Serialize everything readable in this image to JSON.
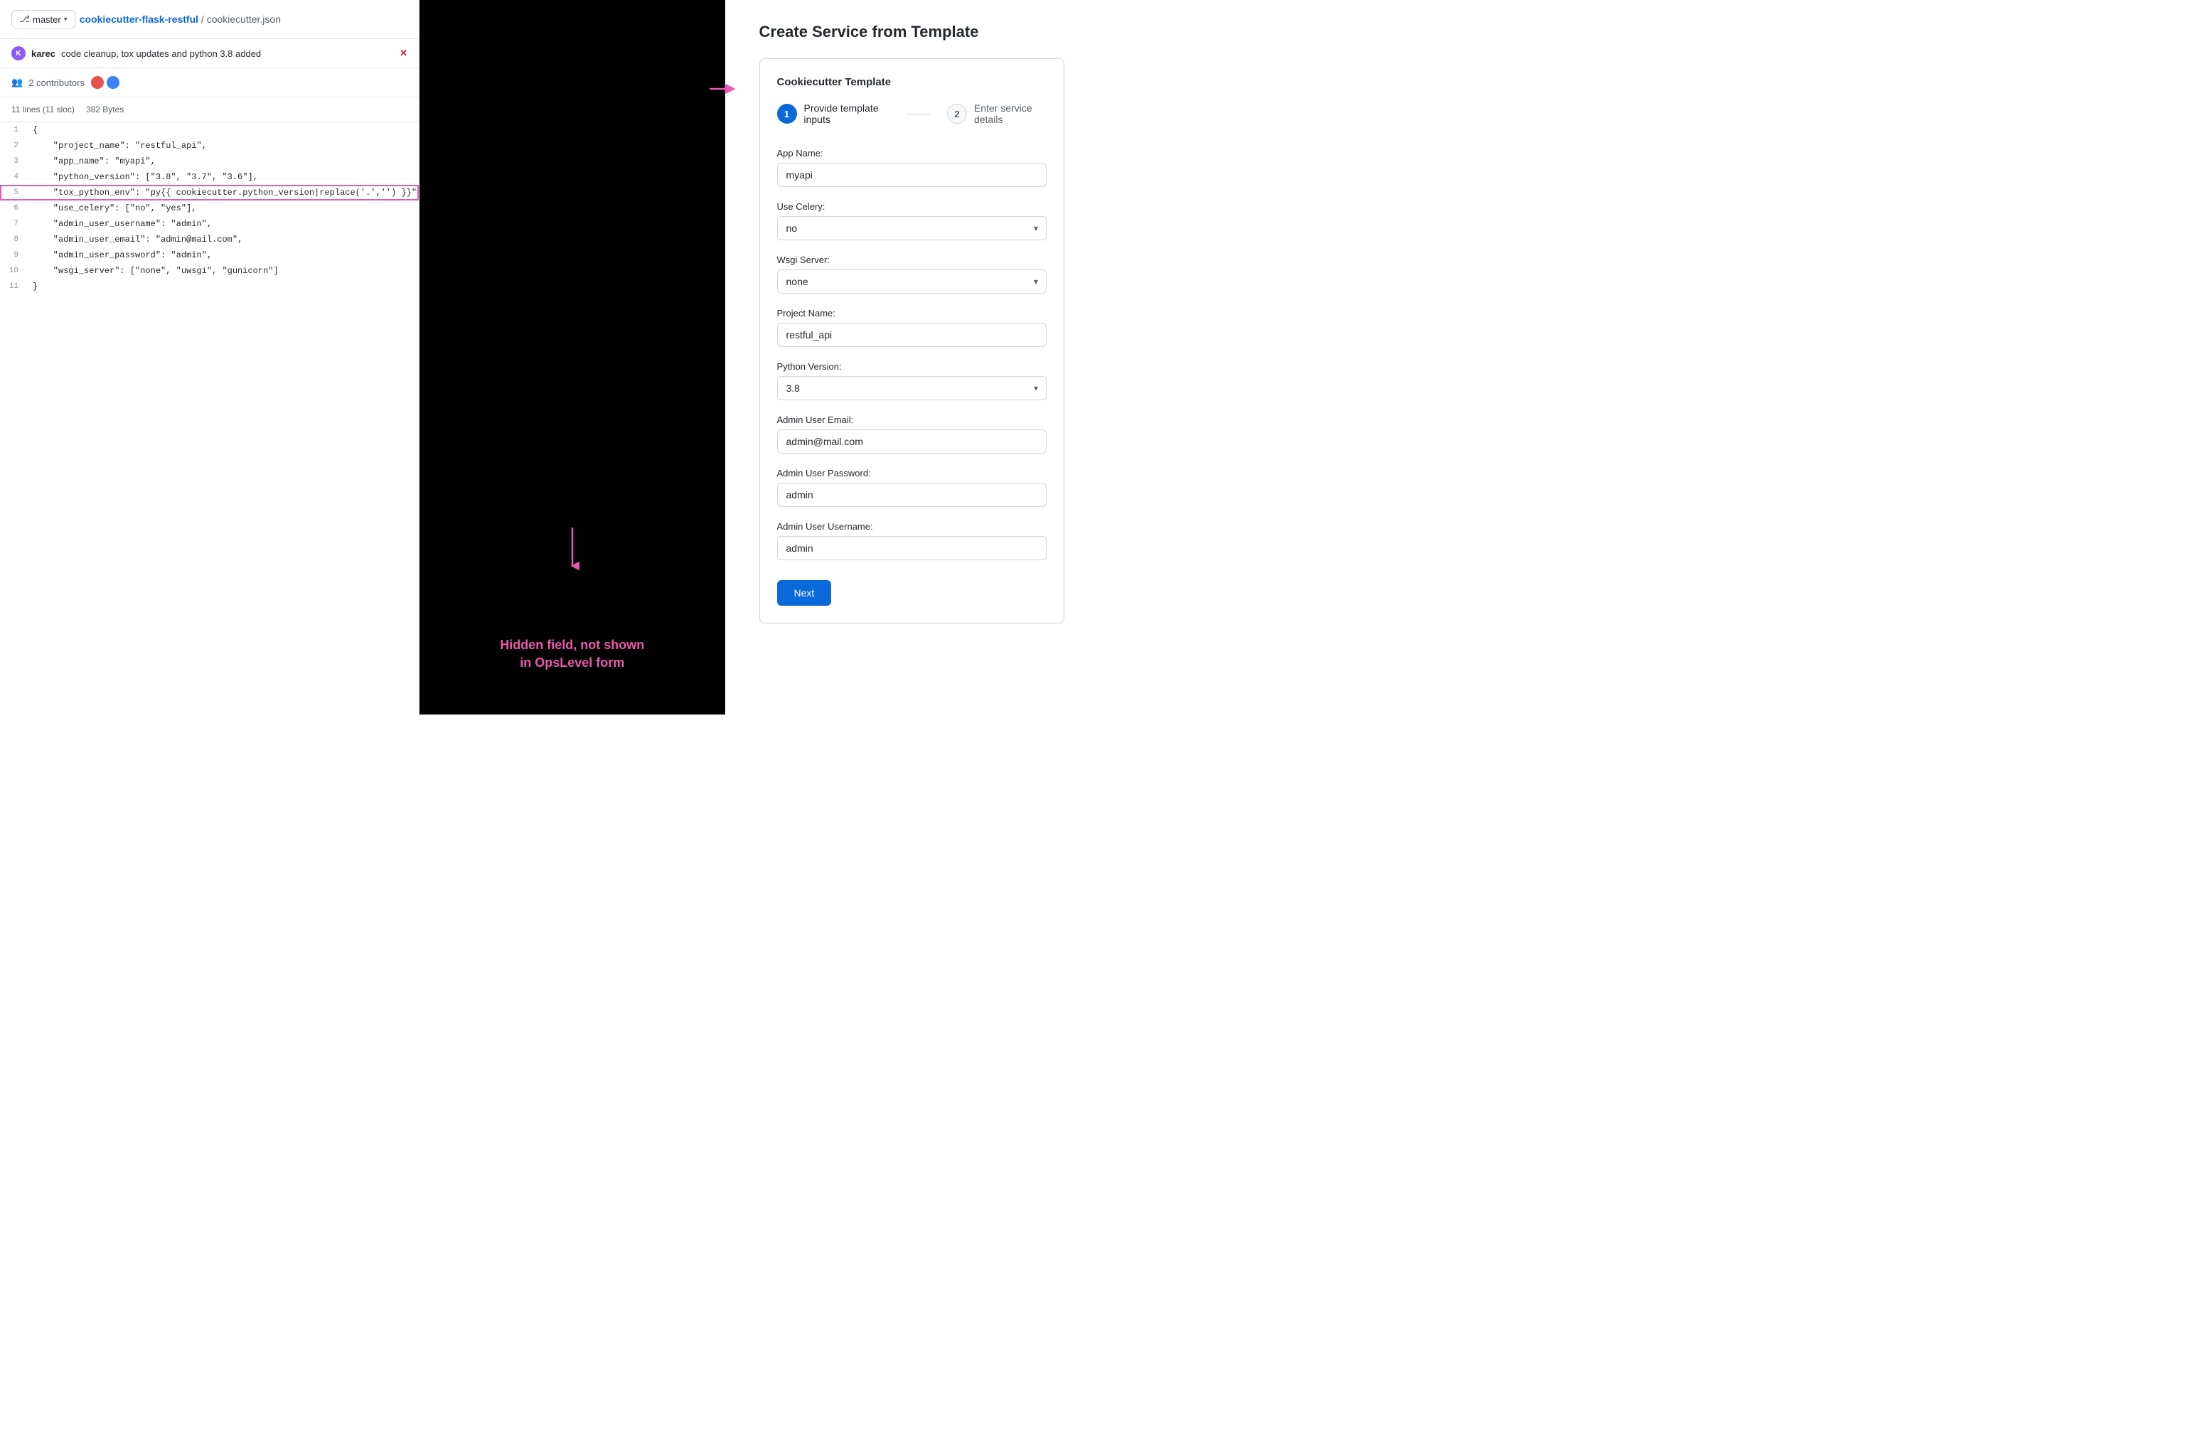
{
  "left": {
    "branch": "master",
    "repo_link_text": "cookiecutter-flask-restful",
    "separator": "/",
    "file_name": "cookiecutter.json",
    "commit_author": "karec",
    "commit_message": "code cleanup, tox updates and python 3.8 added",
    "commit_x": "✕",
    "contributors_label": "2 contributors",
    "file_meta_lines": "11 lines (11 sloc)",
    "file_meta_size": "382 Bytes",
    "code_lines": [
      {
        "num": "1",
        "content": "{"
      },
      {
        "num": "2",
        "content": "    \"project_name\": \"restful_api\","
      },
      {
        "num": "3",
        "content": "    \"app_name\": \"myapi\","
      },
      {
        "num": "4",
        "content": "    \"python_version\": [\"3.8\", \"3.7\", \"3.6\"],"
      },
      {
        "num": "5",
        "content": "    \"tox_python_env\": \"py{{ cookiecutter.python_version|replace('.','') }}\","
      },
      {
        "num": "6",
        "content": "    \"use_celery\": [\"no\", \"yes\"],"
      },
      {
        "num": "7",
        "content": "    \"admin_user_username\": \"admin\","
      },
      {
        "num": "8",
        "content": "    \"admin_user_email\": \"admin@mail.com\","
      },
      {
        "num": "9",
        "content": "    \"admin_user_password\": \"admin\","
      },
      {
        "num": "10",
        "content": "    \"wsgi_server\": [\"none\", \"uwsgi\", \"gunicorn\"]"
      },
      {
        "num": "11",
        "content": "}"
      }
    ],
    "annotation_line1": "Hidden field, not shown",
    "annotation_line2": "in OpsLevel form"
  },
  "right": {
    "page_title": "Create Service from Template",
    "card_title": "Cookiecutter Template",
    "steps": [
      {
        "num": "1",
        "label": "Provide template inputs",
        "active": true
      },
      {
        "num": "2",
        "label": "Enter service details",
        "active": false
      }
    ],
    "fields": [
      {
        "id": "app_name",
        "label": "App Name:",
        "type": "input",
        "value": "myapi",
        "placeholder": ""
      },
      {
        "id": "use_celery",
        "label": "Use Celery:",
        "type": "select",
        "value": "no",
        "options": [
          "no",
          "yes"
        ]
      },
      {
        "id": "wsgi_server",
        "label": "Wsgi Server:",
        "type": "select",
        "value": "none",
        "options": [
          "none",
          "uwsgi",
          "gunicorn"
        ]
      },
      {
        "id": "project_name",
        "label": "Project Name:",
        "type": "input",
        "value": "restful_api",
        "placeholder": ""
      },
      {
        "id": "python_version",
        "label": "Python Version:",
        "type": "select",
        "value": "3.8",
        "options": [
          "3.8",
          "3.7",
          "3.6"
        ]
      },
      {
        "id": "admin_user_email",
        "label": "Admin User Email:",
        "type": "input",
        "value": "admin@mail.com",
        "placeholder": ""
      },
      {
        "id": "admin_user_password",
        "label": "Admin User Password:",
        "type": "input",
        "value": "admin",
        "placeholder": ""
      },
      {
        "id": "admin_user_username",
        "label": "Admin User Username:",
        "type": "input",
        "value": "admin",
        "placeholder": ""
      }
    ],
    "next_button_label": "Next"
  }
}
